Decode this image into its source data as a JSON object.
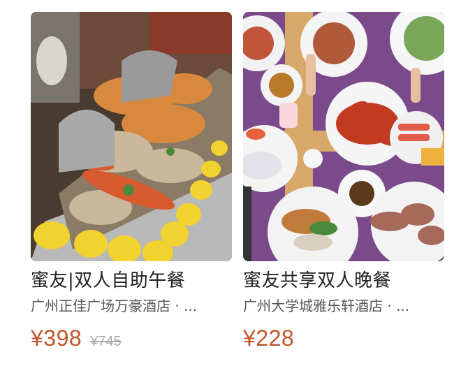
{
  "cards": [
    {
      "title": "蜜友|双人自助午餐",
      "subtitle": "广州正佳广场万豪酒店 · ...",
      "price": "¥398",
      "original_price": "¥745",
      "image": "seafood-buffet-photo"
    },
    {
      "title": "蜜友共享双人晚餐",
      "subtitle": "广州大学城雅乐轩酒店 · ...",
      "price": "¥228",
      "image": "dinner-table-photo"
    }
  ],
  "colors": {
    "price": "#c0562c",
    "title": "#222222",
    "subtitle": "#555555",
    "strike_price": "#aaaaaa"
  }
}
